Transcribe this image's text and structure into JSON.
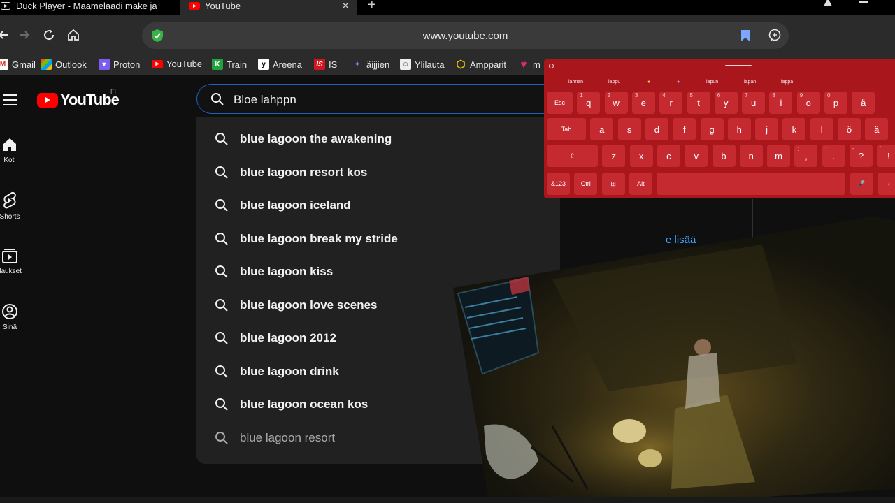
{
  "browser": {
    "tabs": [
      {
        "label": "Duck Player - Maamelaadi make ja"
      },
      {
        "label": "YouTube",
        "close": "✕"
      }
    ],
    "new_tab": "+",
    "url": "www.youtube.com",
    "bookmarks": [
      {
        "label": "Gmail",
        "icon": "gmail-icon"
      },
      {
        "label": "Outlook",
        "icon": "outlook-icon"
      },
      {
        "label": "Proton",
        "icon": "proton-icon"
      },
      {
        "label": "YouTube",
        "icon": "youtube-icon"
      },
      {
        "label": "Train",
        "icon": "train-icon"
      },
      {
        "label": "Areena",
        "icon": "areena-icon"
      },
      {
        "label": "IS",
        "icon": "is-icon"
      },
      {
        "label": "äijjien",
        "icon": "aijjien-icon"
      },
      {
        "label": "Ylilauta",
        "icon": "ylilauta-icon"
      },
      {
        "label": "Ampparit",
        "icon": "ampparit-icon"
      },
      {
        "label": "m",
        "icon": "heart-icon"
      }
    ]
  },
  "youtube": {
    "logo_text": "YouTube",
    "region": "FI",
    "sidebar": [
      {
        "label": "Koti",
        "icon": "home-icon"
      },
      {
        "label": "Shorts",
        "icon": "shorts-icon"
      },
      {
        "label": "ilaukset",
        "icon": "subscriptions-icon"
      },
      {
        "label": "Sinä",
        "icon": "you-icon"
      }
    ],
    "search_value": "Bloe lahppn",
    "suggestions": [
      "blue lagoon the awakening",
      "blue lagoon resort kos",
      "blue lagoon iceland",
      "blue lagoon break my stride",
      "blue lagoon kiss",
      "blue lagoon love scenes",
      "blue lagoon 2012",
      "blue lagoon drink",
      "blue lagoon ocean kos",
      "blue lagoon resort"
    ],
    "show_more": "e lisää"
  },
  "keyboard": {
    "accent": "#a9161c",
    "candidates": [
      "lahnan",
      "lappu",
      "lapun",
      "lapan",
      "läppä"
    ],
    "row1": [
      {
        "k": "Esc",
        "s": ""
      },
      {
        "k": "q",
        "s": "1"
      },
      {
        "k": "w",
        "s": "2"
      },
      {
        "k": "e",
        "s": "3"
      },
      {
        "k": "r",
        "s": "4"
      },
      {
        "k": "t",
        "s": "5"
      },
      {
        "k": "y",
        "s": "6"
      },
      {
        "k": "u",
        "s": "7"
      },
      {
        "k": "i",
        "s": "8"
      },
      {
        "k": "o",
        "s": "9"
      },
      {
        "k": "p",
        "s": "0"
      },
      {
        "k": "å",
        "s": ""
      }
    ],
    "row2": [
      {
        "k": "Tab",
        "s": ""
      },
      {
        "k": "a",
        "s": ""
      },
      {
        "k": "s",
        "s": ""
      },
      {
        "k": "d",
        "s": ""
      },
      {
        "k": "f",
        "s": ""
      },
      {
        "k": "g",
        "s": ""
      },
      {
        "k": "h",
        "s": ""
      },
      {
        "k": "j",
        "s": ""
      },
      {
        "k": "k",
        "s": ""
      },
      {
        "k": "l",
        "s": ""
      },
      {
        "k": "ö",
        "s": ""
      },
      {
        "k": "ä",
        "s": ""
      }
    ],
    "row3": [
      {
        "k": "⇧",
        "s": ""
      },
      {
        "k": "z",
        "s": ""
      },
      {
        "k": "x",
        "s": ""
      },
      {
        "k": "c",
        "s": ""
      },
      {
        "k": "v",
        "s": ""
      },
      {
        "k": "b",
        "s": ""
      },
      {
        "k": "n",
        "s": ""
      },
      {
        "k": "m",
        "s": ""
      },
      {
        "k": ",",
        "s": ";"
      },
      {
        "k": ".",
        "s": ":"
      },
      {
        "k": "?",
        "s": "-"
      },
      {
        "k": "!",
        "s": "'"
      }
    ],
    "row4": [
      {
        "k": "&123",
        "s": ""
      },
      {
        "k": "Ctrl",
        "s": ""
      },
      {
        "k": "⊞",
        "s": ""
      },
      {
        "k": "Alt",
        "s": ""
      },
      {
        "k": "",
        "s": ""
      },
      {
        "k": "🎤",
        "s": ""
      },
      {
        "k": "‹",
        "s": ""
      }
    ]
  }
}
